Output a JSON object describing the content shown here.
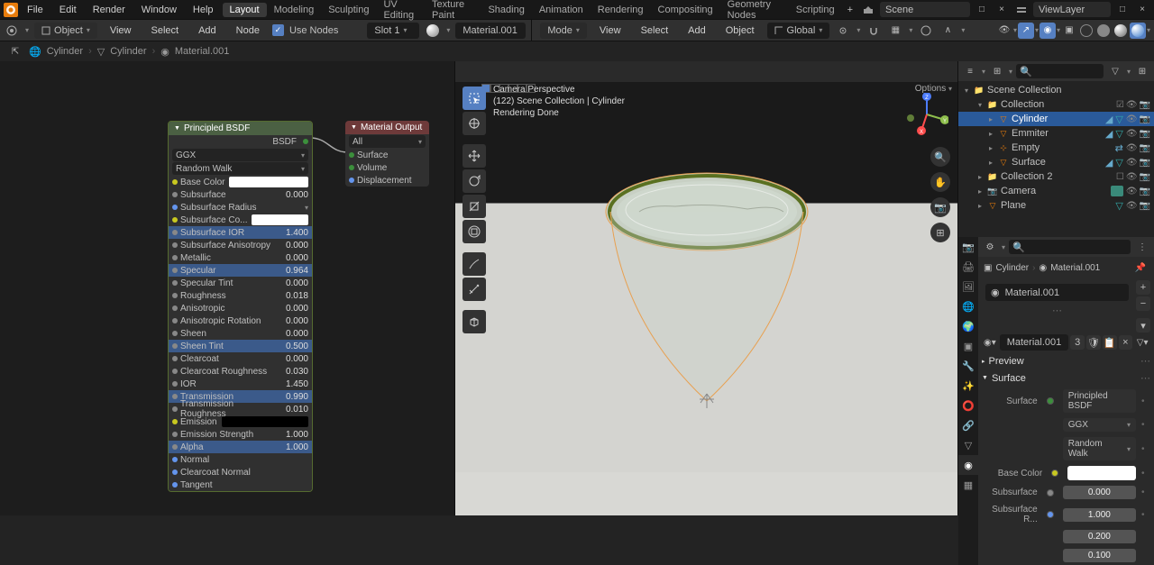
{
  "topmenu": {
    "file": "File",
    "edit": "Edit",
    "render": "Render",
    "window": "Window",
    "help": "Help"
  },
  "workspaces": [
    "Layout",
    "Modeling",
    "Sculpting",
    "UV Editing",
    "Texture Paint",
    "Shading",
    "Animation",
    "Rendering",
    "Compositing",
    "Geometry Nodes",
    "Scripting"
  ],
  "active_workspace_index": 0,
  "scene_label": "Scene",
  "viewlayer_label": "ViewLayer",
  "node_header": {
    "mode": "Object",
    "view": "View",
    "select": "Select",
    "add": "Add",
    "node": "Node",
    "use_nodes": "Use Nodes",
    "slot": "Slot 1",
    "material": "Material.001"
  },
  "vp_header": {
    "mode": "Mode",
    "view": "View",
    "select": "Select",
    "add": "Add",
    "object": "Object",
    "orient": "Global"
  },
  "breadcrumb": {
    "obj": "Cylinder",
    "obj2": "Cylinder",
    "mat": "Material.001"
  },
  "bsdf_node": {
    "title": "Principled BSDF",
    "bsdf_out": "BSDF",
    "distribution": "GGX",
    "sss_method": "Random Walk",
    "props": [
      {
        "name": "Base Color",
        "type": "swatch",
        "dot": "yellow"
      },
      {
        "name": "Subsurface",
        "val": "0.000",
        "dot": "gray"
      },
      {
        "name": "Subsurface Radius",
        "type": "dd",
        "dot": "blue"
      },
      {
        "name": "Subsurface Co...",
        "type": "swatch",
        "dot": "yellow"
      },
      {
        "name": "Subsurface IOR",
        "val": "1.400",
        "dot": "gray",
        "sel": true
      },
      {
        "name": "Subsurface Anisotropy",
        "val": "0.000",
        "dot": "gray"
      },
      {
        "name": "Metallic",
        "val": "0.000",
        "dot": "gray"
      },
      {
        "name": "Specular",
        "val": "0.964",
        "dot": "gray",
        "sel": true
      },
      {
        "name": "Specular Tint",
        "val": "0.000",
        "dot": "gray"
      },
      {
        "name": "Roughness",
        "val": "0.018",
        "dot": "gray"
      },
      {
        "name": "Anisotropic",
        "val": "0.000",
        "dot": "gray"
      },
      {
        "name": "Anisotropic Rotation",
        "val": "0.000",
        "dot": "gray"
      },
      {
        "name": "Sheen",
        "val": "0.000",
        "dot": "gray"
      },
      {
        "name": "Sheen Tint",
        "val": "0.500",
        "dot": "gray",
        "sel": true
      },
      {
        "name": "Clearcoat",
        "val": "0.000",
        "dot": "gray"
      },
      {
        "name": "Clearcoat Roughness",
        "val": "0.030",
        "dot": "gray"
      },
      {
        "name": "IOR",
        "val": "1.450",
        "dot": "gray"
      },
      {
        "name": "Transmission",
        "val": "0.990",
        "dot": "gray",
        "sel": true
      },
      {
        "name": "Transmission Roughness",
        "val": "0.010",
        "dot": "gray"
      },
      {
        "name": "Emission",
        "type": "swatch_black",
        "dot": "yellow"
      },
      {
        "name": "Emission Strength",
        "val": "1.000",
        "dot": "gray"
      },
      {
        "name": "Alpha",
        "val": "1.000",
        "dot": "gray",
        "sel": true
      },
      {
        "name": "Normal",
        "dot": "blue"
      },
      {
        "name": "Clearcoat Normal",
        "dot": "blue"
      },
      {
        "name": "Tangent",
        "dot": "blue"
      }
    ]
  },
  "out_node": {
    "title": "Material Output",
    "all": "All",
    "surface": "Surface",
    "volume": "Volume",
    "displacement": "Displacement"
  },
  "vp_overlay": {
    "persp": "Camera Perspective",
    "colpath": "(122) Scene Collection | Cylinder",
    "status": "Rendering Done"
  },
  "vp_options": "Options",
  "outliner": {
    "root": "Scene Collection",
    "coll": "Collection",
    "items": [
      {
        "name": "Cylinder",
        "sel": true,
        "ic": "mesh"
      },
      {
        "name": "Emmiter",
        "ic": "mesh"
      },
      {
        "name": "Empty",
        "ic": "empty"
      },
      {
        "name": "Surface",
        "ic": "mesh"
      }
    ],
    "coll2": "Collection 2",
    "camera": "Camera",
    "plane": "Plane"
  },
  "props": {
    "bc_obj": "Cylinder",
    "bc_mat": "Material.001",
    "mat_name": "Material.001",
    "mat_browse": "Material.001",
    "mat_users": "3",
    "preview": "Preview",
    "surface": "Surface",
    "surface_lbl": "Surface",
    "surface_val": "Principled BSDF",
    "distribution": "GGX",
    "sss": "Random Walk",
    "base_color_lbl": "Base Color",
    "subsurface_lbl": "Subsurface",
    "subsurface_val": "0.000",
    "sss_r_lbl": "Subsurface R...",
    "sss_r_vals": [
      "1.000",
      "0.200",
      "0.100"
    ]
  }
}
